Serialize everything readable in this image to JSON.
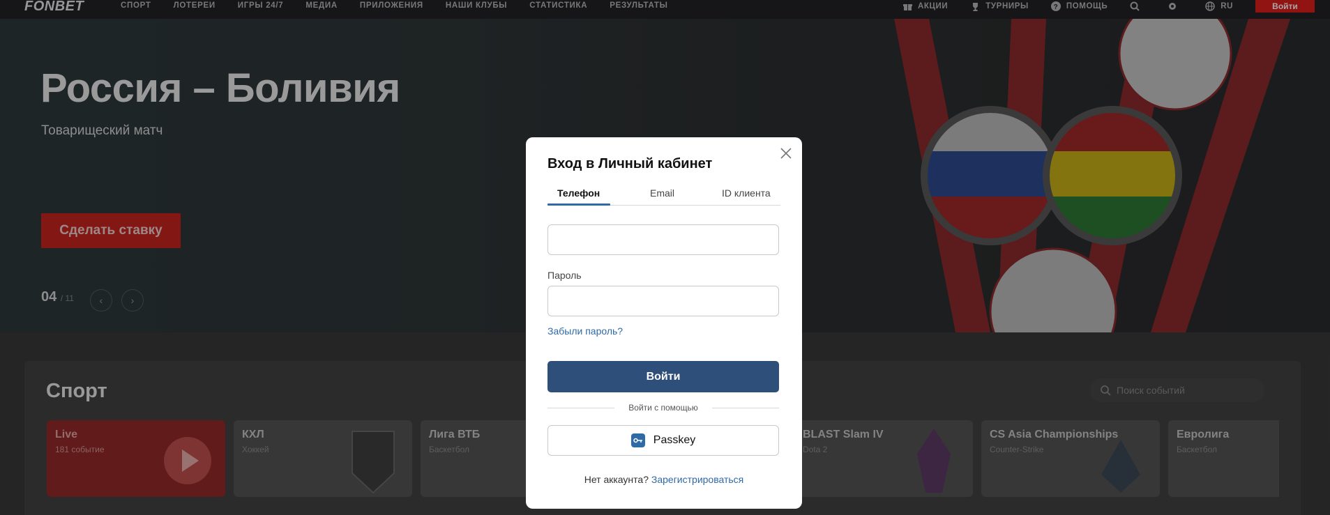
{
  "nav": {
    "logo": "FONBET",
    "items": [
      "СПОРТ",
      "ЛОТЕРЕИ",
      "ИГРЫ 24/7",
      "МЕДИА",
      "ПРИЛОЖЕНИЯ",
      "НАШИ КЛУБЫ",
      "СТАТИСТИКА",
      "РЕЗУЛЬТАТЫ"
    ],
    "promo": "АКЦИИ",
    "tournaments": "ТУРНИРЫ",
    "help": "ПОМОЩЬ",
    "lang": "RU",
    "login": "Войти"
  },
  "hero": {
    "title": "Россия – Боливия",
    "subtitle": "Товарищеский матч",
    "bet_button": "Сделать ставку",
    "slide_current": "04",
    "slide_total": "/ 11"
  },
  "sport": {
    "title": "Спорт",
    "search_placeholder": "Поиск событий",
    "cards": [
      {
        "title": "Live",
        "sub": "181 событие"
      },
      {
        "title": "КХЛ",
        "sub": "Хоккей"
      },
      {
        "title": "Лига ВТБ",
        "sub": "Баскетбол"
      },
      {
        "title": "BLAST Slam IV",
        "sub": "Dota 2"
      },
      {
        "title": "CS Asia Championships",
        "sub": "Counter-Strike"
      },
      {
        "title": "Евролига",
        "sub": "Баскетбол"
      }
    ]
  },
  "modal": {
    "title": "Вход в Личный кабинет",
    "tabs": [
      "Телефон",
      "Email",
      "ID клиента"
    ],
    "password_label": "Пароль",
    "forgot": "Забыли пароль?",
    "submit": "Войти",
    "divider": "Войти с помощью",
    "passkey": "Passkey",
    "footer_text": "Нет аккаунта?",
    "register": "Зарегистрироваться"
  },
  "colors": {
    "accent": "#e0201d",
    "link": "#2f6aa6",
    "submit": "#2f4f7b"
  }
}
